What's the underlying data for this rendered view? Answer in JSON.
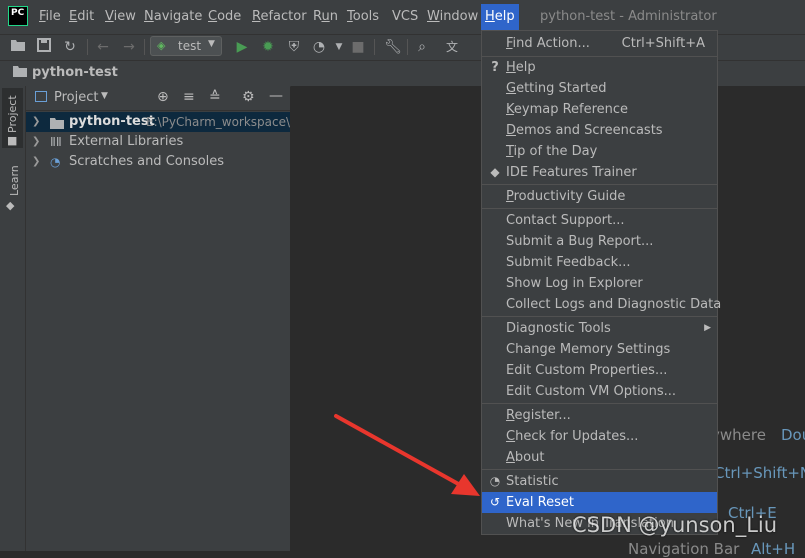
{
  "window": {
    "title": "python-test - Administrator",
    "logo_text": "PC"
  },
  "menubar": {
    "items": [
      "File",
      "Edit",
      "View",
      "Navigate",
      "Code",
      "Refactor",
      "Run",
      "Tools",
      "VCS",
      "Window",
      "Help"
    ]
  },
  "toolbar": {
    "run_config": "test",
    "icons": [
      "open-folder-icon",
      "save-icon",
      "sync-icon",
      "back-icon",
      "forward-icon",
      "run-icon",
      "debug-icon",
      "coverage-icon",
      "profile-icon",
      "stop-icon",
      "wrench-icon",
      "search-icon",
      "translate-icon"
    ]
  },
  "navbar": {
    "breadcrumb": "python-test"
  },
  "left_stripe": {
    "tabs": [
      "Project",
      "Learn"
    ]
  },
  "project_panel": {
    "title": "Project",
    "tree": [
      {
        "name": "python-test",
        "path": "E:\\PyCharm_workspace\\p"
      },
      {
        "name": "External Libraries"
      },
      {
        "name": "Scratches and Consoles"
      }
    ]
  },
  "editor_hints": {
    "line1": "ywhere",
    "line1_key": "Dou",
    "line2": "Ctrl+Shift+N",
    "line3": "Ctrl+E",
    "line4_label": "Navigation Bar",
    "line4_key": "Alt+H"
  },
  "help_menu": {
    "groups": [
      [
        {
          "label": "Find Action...",
          "shortcut": "Ctrl+Shift+A",
          "mnemonic": "F"
        }
      ],
      [
        {
          "label": "Help",
          "icon": "?",
          "mnemonic": "H"
        },
        {
          "label": "Getting Started",
          "mnemonic": "G"
        },
        {
          "label": "Keymap Reference",
          "mnemonic": "K"
        },
        {
          "label": "Demos and Screencasts",
          "mnemonic": "D"
        },
        {
          "label": "Tip of the Day",
          "mnemonic": "T"
        },
        {
          "label": "IDE Features Trainer",
          "icon": "mortarboard"
        }
      ],
      [
        {
          "label": "Productivity Guide",
          "mnemonic": "P"
        }
      ],
      [
        {
          "label": "Contact Support..."
        },
        {
          "label": "Submit a Bug Report..."
        },
        {
          "label": "Submit Feedback..."
        },
        {
          "label": "Show Log in Explorer"
        },
        {
          "label": "Collect Logs and Diagnostic Data"
        }
      ],
      [
        {
          "label": "Diagnostic Tools",
          "submenu": true
        },
        {
          "label": "Change Memory Settings"
        },
        {
          "label": "Edit Custom Properties..."
        },
        {
          "label": "Edit Custom VM Options..."
        }
      ],
      [
        {
          "label": "Register...",
          "mnemonic": "R"
        },
        {
          "label": "Check for Updates...",
          "mnemonic": "C"
        },
        {
          "label": "About",
          "mnemonic": "A"
        }
      ],
      [
        {
          "label": "Statistic",
          "icon": "clock"
        },
        {
          "label": "Eval Reset",
          "icon": "undo",
          "active": true
        },
        {
          "label": "What's New in Translation"
        }
      ]
    ]
  },
  "watermark": "CSDN @yunson_Liu",
  "colors": {
    "accent": "#2f65ca",
    "arrow": "#e8362d",
    "hint": "#6897bb"
  }
}
